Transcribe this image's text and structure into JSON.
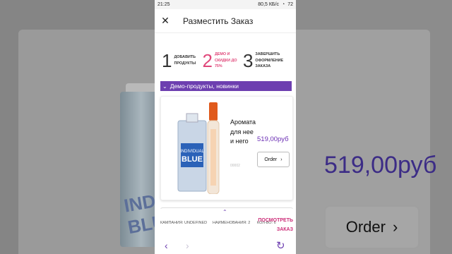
{
  "status_bar": {
    "time": "21:25",
    "speed": "80,5 КБ/с",
    "signal": "72"
  },
  "header": {
    "title": "Разместить Заказ"
  },
  "steps": [
    {
      "num": "1",
      "label": "ДОБАВИТЬ ПРОДУКТЫ"
    },
    {
      "num": "2",
      "label": "ДЕМО И СКИДКИ ДО 75%"
    },
    {
      "num": "3",
      "label": "ЗАВЕРШИТЬ ОФОРМЛЕНИЕ ЗАКАЗА"
    }
  ],
  "section": {
    "label": "Демо-продукты, новинки"
  },
  "product": {
    "name": "Аромата для нее и него",
    "code": "00002",
    "price": "519,00руб",
    "order_label": "Order"
  },
  "summary": {
    "campaign": "КАМПАНИЯ: UNDEFINED",
    "items": "НАИМЕНОВАНИЯ: 2",
    "qty": "КОЛ-ВО: 6",
    "place_order": "ПОСМОТРЕТЬ ЗАКАЗ"
  },
  "background": {
    "price": "519,00руб",
    "order_label": "Order",
    "bottle_label": "INDIVI BLU"
  },
  "colors": {
    "accent": "#6d3fb0",
    "pink": "#e0477a",
    "order_link": "#cc2e79"
  }
}
